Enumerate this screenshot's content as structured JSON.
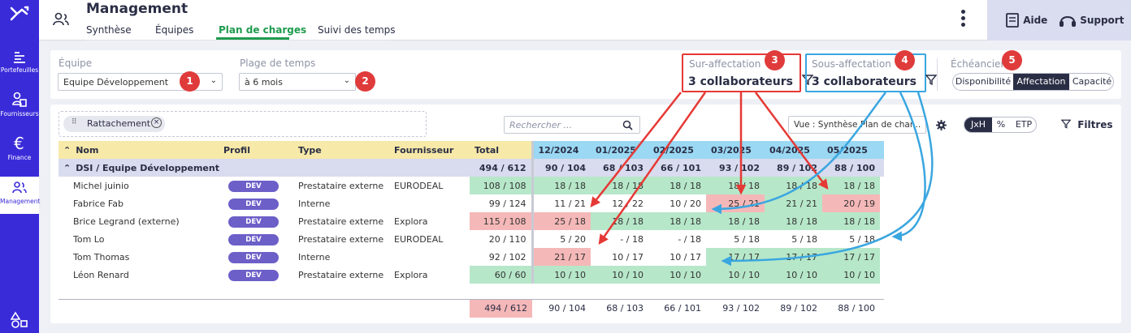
{
  "nav": {
    "items": [
      {
        "label": "Portefeuilles",
        "icon": "portfolio-icon"
      },
      {
        "label": "Fournisseurs",
        "icon": "suppliers-icon"
      },
      {
        "label": "Finance",
        "icon": "euro-icon"
      },
      {
        "label": "Management",
        "icon": "management-icon"
      }
    ]
  },
  "header": {
    "title": "Management",
    "tabs": [
      "Synthèse",
      "Équipes",
      "Plan de charges",
      "Suivi des temps"
    ],
    "active_tab": "Plan de charges",
    "help_label": "Aide",
    "support_label": "Support"
  },
  "filters": {
    "equipe_label": "Équipe",
    "equipe_value": "Equipe Développement",
    "plage_label": "Plage de temps",
    "plage_value": "à 6 mois",
    "sur_label": "Sur-affectation",
    "sur_value": "3 collaborateurs",
    "sous_label": "Sous-affectation",
    "sous_value": "3 collaborateurs",
    "echeancier_label": "Échéancier",
    "echeancier_options": [
      "Disponibilité",
      "Affectation",
      "Capacité"
    ],
    "echeancier_selected": "Affectation"
  },
  "markers": [
    "1",
    "2",
    "3",
    "4",
    "5"
  ],
  "toolbar": {
    "rattachement_label": "Rattachement",
    "search_placeholder": "Rechercher ...",
    "vue_value": "Vue : Synthèse Plan de char...",
    "units": [
      "JxH",
      "%",
      "ETP"
    ],
    "unit_selected": "JxH",
    "filtres_label": "Filtres"
  },
  "table": {
    "columns": [
      "Nom",
      "Profil",
      "Type",
      "Fournisseur",
      "Total"
    ],
    "months": [
      "12/2024",
      "01/2025",
      "02/2025",
      "03/2025",
      "04/2025",
      "05/2025"
    ],
    "group": {
      "name": "DSI / Equipe Développement",
      "total": "494 / 612",
      "months": [
        "90 / 104",
        "68 / 103",
        "66 / 101",
        "93 / 102",
        "89 / 102",
        "88 / 100"
      ]
    },
    "rows": [
      {
        "name": "Michel juinio",
        "profil": "DEV",
        "type": "Prestataire externe",
        "fournisseur": "EURODEAL",
        "total": "108 / 108",
        "total_status": "ok",
        "months": [
          "18 / 18",
          "18 / 18",
          "18 / 18",
          "18 / 18",
          "18 / 18",
          "18 / 18"
        ],
        "status": [
          "ok",
          "ok",
          "ok",
          "ok",
          "ok",
          "ok"
        ]
      },
      {
        "name": "Fabrice Fab",
        "profil": "DEV",
        "type": "Interne",
        "fournisseur": "",
        "total": "99 / 124",
        "total_status": "plain",
        "months": [
          "11 / 21",
          "12 / 22",
          "10 / 20",
          "25 / 21",
          "21 / 21",
          "20 / 19"
        ],
        "status": [
          "plain",
          "plain",
          "plain",
          "over",
          "ok",
          "over"
        ]
      },
      {
        "name": "Brice Legrand (externe)",
        "profil": "DEV",
        "type": "Prestataire externe",
        "fournisseur": "Explora",
        "total": "115 / 108",
        "total_status": "over",
        "months": [
          "25 / 18",
          "18 / 18",
          "18 / 18",
          "18 / 18",
          "18 / 18",
          "18 / 18"
        ],
        "status": [
          "over",
          "ok",
          "ok",
          "ok",
          "ok",
          "ok"
        ]
      },
      {
        "name": "Tom Lo",
        "profil": "DEV",
        "type": "Prestataire externe",
        "fournisseur": "EURODEAL",
        "total": "20 / 110",
        "total_status": "plain",
        "months": [
          "5 / 20",
          "- / 18",
          "- / 18",
          "5 / 18",
          "5 / 18",
          "5 / 18"
        ],
        "status": [
          "plain",
          "plain",
          "plain",
          "plain",
          "plain",
          "plain"
        ]
      },
      {
        "name": "Tom Thomas",
        "profil": "DEV",
        "type": "Interne",
        "fournisseur": "",
        "total": "92 / 102",
        "total_status": "plain",
        "months": [
          "21 / 17",
          "10 / 17",
          "10 / 17",
          "17 / 17",
          "17 / 17",
          "17 / 17"
        ],
        "status": [
          "over",
          "plain",
          "plain",
          "ok",
          "ok",
          "ok"
        ]
      },
      {
        "name": "Léon Renard",
        "profil": "DEV",
        "type": "Prestataire externe",
        "fournisseur": "Explora",
        "total": "60 / 60",
        "total_status": "ok",
        "months": [
          "10 / 10",
          "10 / 10",
          "10 / 10",
          "10 / 10",
          "10 / 10",
          "10 / 10"
        ],
        "status": [
          "ok",
          "ok",
          "ok",
          "ok",
          "ok",
          "ok"
        ]
      }
    ],
    "footer": {
      "total": "494 / 612",
      "months": [
        "90 / 104",
        "68 / 103",
        "66 / 101",
        "93 / 102",
        "89 / 102",
        "88 / 100"
      ]
    }
  },
  "colors": {
    "nav_bg": "#3a2bd9",
    "accent_green": "#1f9b4f",
    "ok_cell": "#b6e7c9",
    "over_cell": "#f5b8b8",
    "sur_arrow": "#e53935",
    "sous_arrow": "#3aa6e0"
  }
}
